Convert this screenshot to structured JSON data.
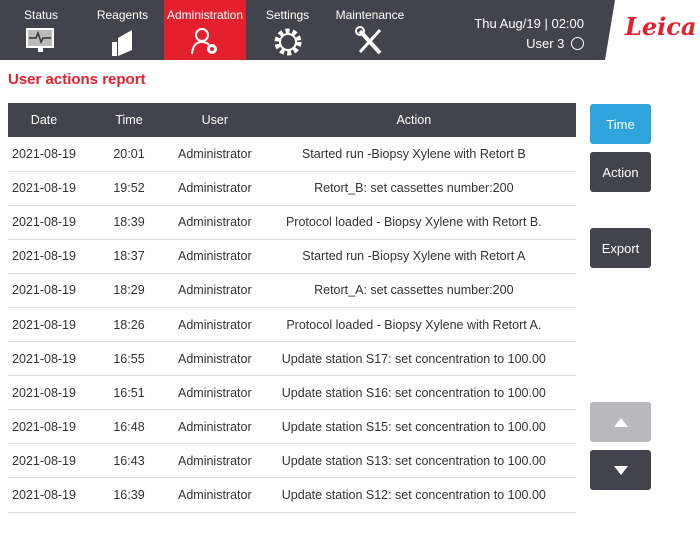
{
  "nav": {
    "tabs": [
      {
        "label": "Status",
        "icon": "monitor-icon"
      },
      {
        "label": "Reagents",
        "icon": "reagent-bottle-icon"
      },
      {
        "label": "Administration",
        "icon": "user-gear-icon",
        "active": true
      },
      {
        "label": "Settings",
        "icon": "gear-icon"
      },
      {
        "label": "Maintenance",
        "icon": "tools-icon"
      }
    ],
    "datetime": "Thu Aug/19 | 02:00",
    "user": "User 3",
    "logo": "Leica"
  },
  "page": {
    "title": "User actions report"
  },
  "table": {
    "columns": [
      "Date",
      "Time",
      "User",
      "Action"
    ],
    "rows": [
      [
        "2021-08-19",
        "20:01",
        "Administrator",
        "Started run -Biopsy Xylene with Retort B"
      ],
      [
        "2021-08-19",
        "19:52",
        "Administrator",
        "Retort_B: set cassettes number:200"
      ],
      [
        "2021-08-19",
        "18:39",
        "Administrator",
        "Protocol loaded - Biopsy Xylene with Retort B."
      ],
      [
        "2021-08-19",
        "18:37",
        "Administrator",
        "Started run -Biopsy Xylene with Retort A"
      ],
      [
        "2021-08-19",
        "18:29",
        "Administrator",
        "Retort_A: set cassettes number:200"
      ],
      [
        "2021-08-19",
        "18:26",
        "Administrator",
        "Protocol loaded - Biopsy Xylene with Retort A."
      ],
      [
        "2021-08-19",
        "16:55",
        "Administrator",
        "Update station S17: set concentration to 100.00"
      ],
      [
        "2021-08-19",
        "16:51",
        "Administrator",
        "Update station S16: set concentration to 100.00"
      ],
      [
        "2021-08-19",
        "16:48",
        "Administrator",
        "Update station S15: set concentration to 100.00"
      ],
      [
        "2021-08-19",
        "16:43",
        "Administrator",
        "Update station S13: set concentration to 100.00"
      ],
      [
        "2021-08-19",
        "16:39",
        "Administrator",
        "Update station S12: set concentration to 100.00"
      ]
    ]
  },
  "buttons": {
    "time": "Time",
    "action": "Action",
    "export": "Export"
  },
  "colors": {
    "accent_red": "#e5202e",
    "selected_blue": "#2ea3dc",
    "dark": "#43434d",
    "disabled": "#b9b9bd"
  }
}
